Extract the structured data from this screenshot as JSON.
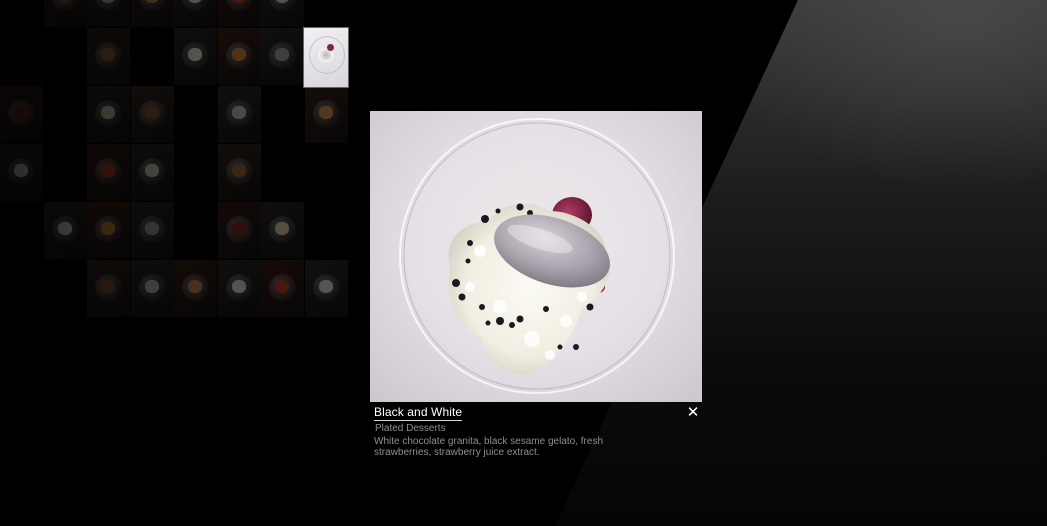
{
  "lightbox": {
    "title": "Black and White",
    "category": "Plated Desserts",
    "description": "White chocolate granita, black sesame gelato, fresh strawberries, strawberry juice extract.",
    "close_label": "✕",
    "photo_alt": "Black and White dessert"
  },
  "gallery": {
    "active_thumb_alt": "Black and White thumbnail"
  }
}
